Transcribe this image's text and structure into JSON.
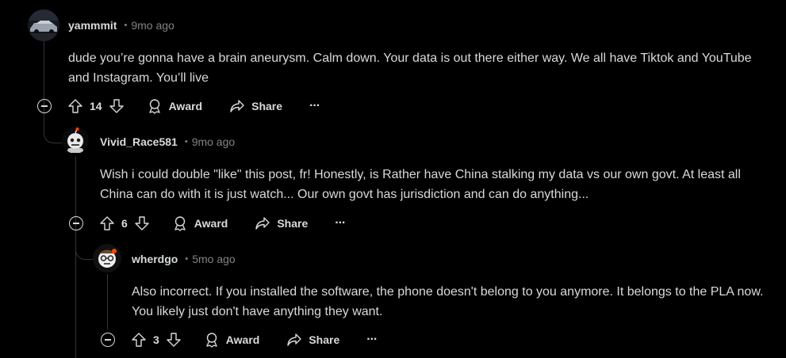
{
  "comments": [
    {
      "username": "yammmit",
      "time": "9mo ago",
      "body": "dude you’re gonna have a brain aneurysm. Calm down. Your data is out there either way. We all have Tiktok and YouTube and Instagram. You’ll live",
      "score": "14",
      "award_label": "Award",
      "share_label": "Share",
      "more_label": "···"
    },
    {
      "username": "Vivid_Race581",
      "time": "9mo ago",
      "body": "Wish i could double \"like\" this post, fr! Honestly, is Rather have China stalking my data vs our own govt. At least all China can do with it is just watch... Our own govt has jurisdiction and can do anything...",
      "score": "6",
      "award_label": "Award",
      "share_label": "Share",
      "more_label": "···"
    },
    {
      "username": "wherdgo",
      "time": "5mo ago",
      "body": "Also incorrect. If you installed the software, the phone doesn't belong to you anymore. It belongs to the PLA now. You likely just don't have anything they want.",
      "score": "3",
      "award_label": "Award",
      "share_label": "Share",
      "more_label": "···"
    }
  ],
  "separator": "•",
  "icons": {
    "collapse": "collapse-icon",
    "upvote": "upvote-icon",
    "downvote": "downvote-icon",
    "award": "award-icon",
    "share": "share-icon",
    "more": "more-icon"
  },
  "colors": {
    "background": "#000000",
    "text": "#d7dadc",
    "meta": "#818384",
    "thread_line": "#343536"
  }
}
